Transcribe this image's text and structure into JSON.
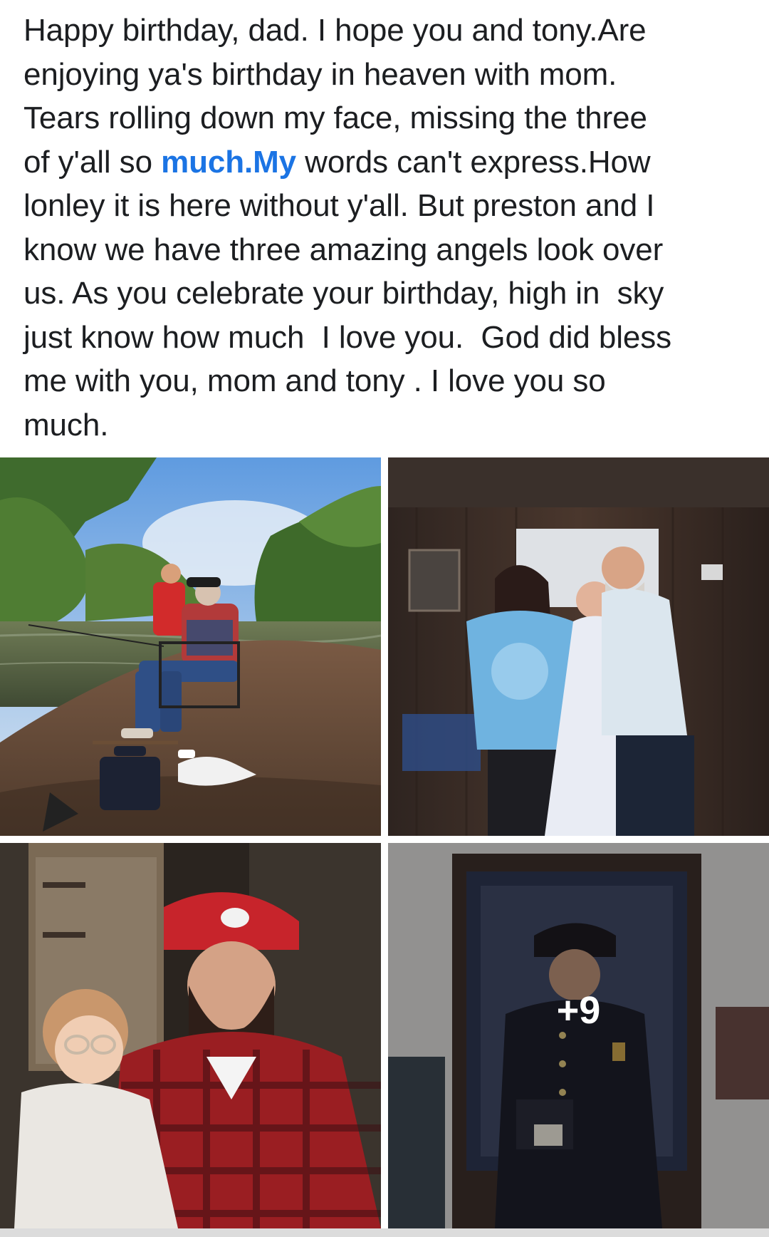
{
  "post": {
    "lines": [
      {
        "text": "Happy birthday, dad. I hope you and tony.Are"
      },
      {
        "text": "enjoying ya's birthday in heaven with mom."
      },
      {
        "text": "Tears rolling down my face, missing the three"
      },
      {
        "pre": "of y'all so ",
        "link": "much.My",
        "post": " words can't express.How"
      },
      {
        "text": "lonley it is here without y'all. But preston and I"
      },
      {
        "text": "know we have three amazing angels look over"
      },
      {
        "text": "us. As you celebrate your birthday, high in  sky"
      },
      {
        "text": "just know how much  I love you.  God did bless"
      },
      {
        "text": "me with you, mom and tony . I love you so"
      },
      {
        "text": "much."
      }
    ]
  },
  "photos": {
    "more_count": "+9"
  },
  "colors": {
    "text": "#1c1e21",
    "link": "#1b74e4"
  }
}
